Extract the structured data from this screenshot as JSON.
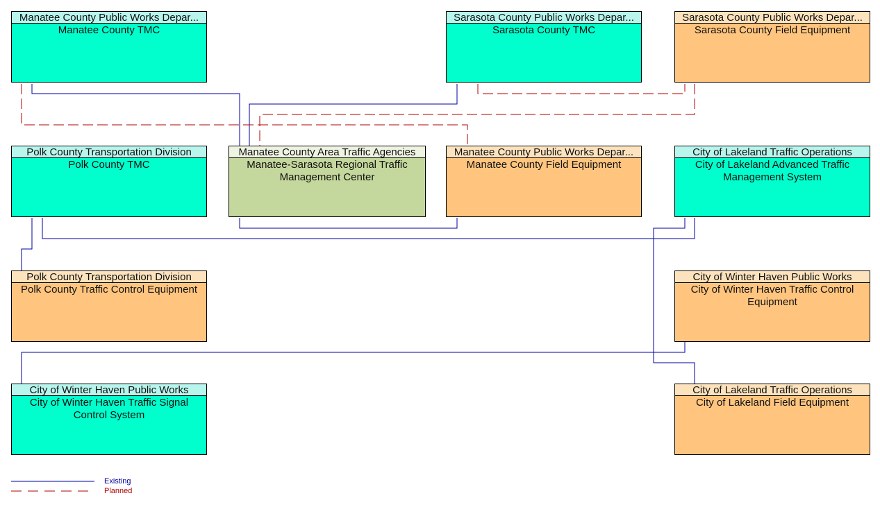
{
  "nodes": [
    {
      "id": "manatee-tmc",
      "owner": "Manatee County Public Works Depar...",
      "name": "Manatee County TMC",
      "type": "cyan"
    },
    {
      "id": "sarasota-tmc",
      "owner": "Sarasota County Public Works Depar...",
      "name": "Sarasota County TMC",
      "type": "cyan"
    },
    {
      "id": "sarasota-field",
      "owner": "Sarasota County Public Works Depar...",
      "name": "Sarasota County Field Equipment",
      "type": "orange"
    },
    {
      "id": "polk-tmc",
      "owner": "Polk County Transportation Division",
      "name": "Polk County TMC",
      "type": "cyan"
    },
    {
      "id": "regional-tmc",
      "owner": "Manatee County Area Traffic Agencies",
      "name": "Manatee-Sarasota Regional Traffic Management Center",
      "type": "green"
    },
    {
      "id": "manatee-field",
      "owner": "Manatee County Public Works Depar...",
      "name": "Manatee County Field Equipment",
      "type": "orange"
    },
    {
      "id": "lakeland-atms",
      "owner": "City of Lakeland Traffic Operations",
      "name": "City of Lakeland Advanced Traffic Management System",
      "type": "cyan"
    },
    {
      "id": "polk-tce",
      "owner": "Polk County Transportation Division",
      "name": "Polk County Traffic Control Equipment",
      "type": "orange"
    },
    {
      "id": "winterhaven-tce",
      "owner": "City of Winter Haven Public Works",
      "name": "City of Winter Haven Traffic Control Equipment",
      "type": "orange"
    },
    {
      "id": "winterhaven-tscs",
      "owner": "City of Winter Haven Public Works",
      "name": "City of Winter Haven Traffic Signal Control System",
      "type": "cyan"
    },
    {
      "id": "lakeland-field",
      "owner": "City of Lakeland Traffic Operations",
      "name": "City of Lakeland Field Equipment",
      "type": "orange"
    }
  ],
  "connections": [
    {
      "from": "manatee-tmc",
      "to": "regional-tmc",
      "status": "existing"
    },
    {
      "from": "manatee-tmc",
      "to": "manatee-field",
      "status": "planned"
    },
    {
      "from": "sarasota-tmc",
      "to": "regional-tmc",
      "status": "existing"
    },
    {
      "from": "sarasota-tmc",
      "to": "sarasota-field",
      "status": "planned"
    },
    {
      "from": "sarasota-field",
      "to": "regional-tmc",
      "status": "planned"
    },
    {
      "from": "regional-tmc",
      "to": "manatee-field",
      "status": "existing"
    },
    {
      "from": "polk-tmc",
      "to": "polk-tce",
      "status": "existing"
    },
    {
      "from": "polk-tmc",
      "to": "lakeland-atms",
      "status": "existing"
    },
    {
      "from": "lakeland-atms",
      "to": "lakeland-field",
      "status": "existing"
    },
    {
      "from": "winterhaven-tce",
      "to": "winterhaven-tscs",
      "status": "existing"
    }
  ],
  "legend": {
    "existing": {
      "label": "Existing",
      "color": "#00009f"
    },
    "planned": {
      "label": "Planned",
      "color": "#b20000"
    }
  },
  "colors": {
    "existing_line": "#0000a0",
    "planned_line": "#b00000"
  }
}
